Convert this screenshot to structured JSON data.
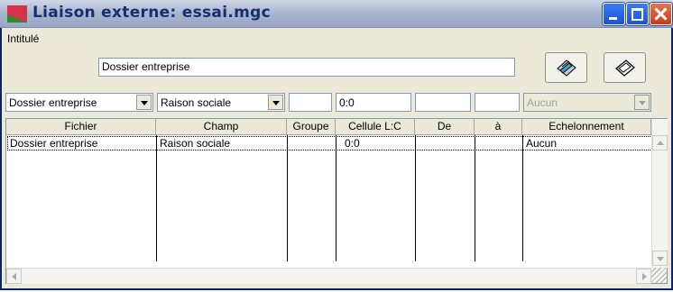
{
  "window": {
    "title": "Liaison externe: essai.mgc"
  },
  "form": {
    "intitule_label": "Intitulé",
    "intitule_value": "Dossier entreprise"
  },
  "filters": {
    "fichier": "Dossier entreprise",
    "champ": "Raison sociale",
    "groupe": "",
    "cellule": "0:0",
    "de": "",
    "a": "",
    "echelonnement": "Aucun"
  },
  "table": {
    "columns": [
      "Fichier",
      "Champ",
      "Groupe",
      "Cellule L:C",
      "De",
      "à",
      "Echelonnement"
    ],
    "rows": [
      [
        "Dossier entreprise",
        "Raison sociale",
        "",
        "0:0",
        "",
        "",
        "Aucun"
      ]
    ]
  },
  "icons": {
    "app": "app-icon",
    "button1": "edit-icon",
    "button2": "eraser-icon"
  }
}
